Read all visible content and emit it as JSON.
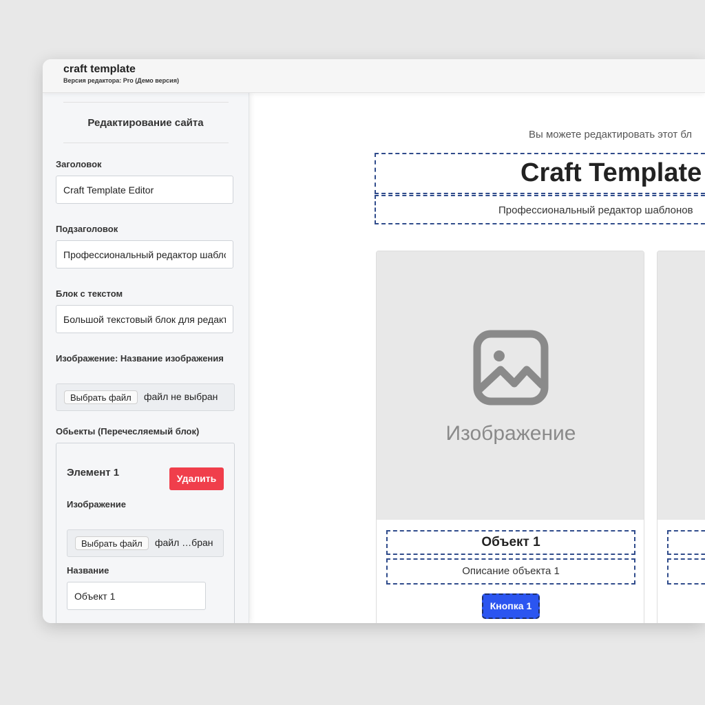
{
  "app": {
    "title": "craft template",
    "subtitle": "Версия редактора: Pro (Демо версия)"
  },
  "sidebar": {
    "heading": "Редактирование сайта",
    "fields": {
      "title_label": "Заголовок",
      "title_value": "Craft Template Editor",
      "subtitle_label": "Подзаголовок",
      "subtitle_value": "Профессиональный редактор шаблонов",
      "text_label": "Блок с текстом",
      "text_value": "Большой текстовый блок для редактирования",
      "image_label": "Изображение: Название изображения",
      "file_button": "Выбрать файл",
      "file_status": "файл не выбран"
    },
    "objects": {
      "label": "Обьекты (Перечесляемый блок)",
      "element_title": "Элемент 1",
      "delete_button": "Удалить",
      "image_label": "Изображение",
      "file_button": "Выбрать файл",
      "file_status": "файл …бран",
      "name_label": "Название",
      "name_value": "Объект 1"
    }
  },
  "preview": {
    "hint": "Вы можете редактировать этот бл",
    "title": "Craft Template",
    "subtitle": "Профессиональный редактор шаблонов",
    "card": {
      "image_placeholder": "Изображение",
      "title": "Объект 1",
      "description": "Описание объекта 1",
      "button": "Кнопка 1"
    }
  },
  "colors": {
    "accent_blue": "#2b55f0",
    "danger_red": "#f03e4b",
    "dashed_outline": "#2f4b8b"
  }
}
